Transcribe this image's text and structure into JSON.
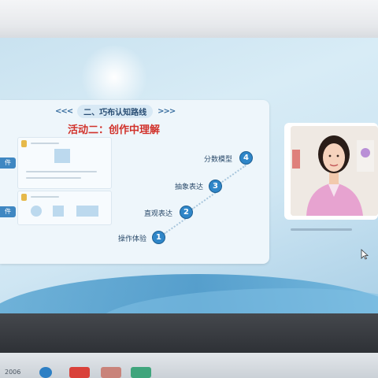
{
  "slide": {
    "section_header": "二、巧布认知路线",
    "left_arrows": "<<<",
    "right_arrows": ">>>",
    "activity_title": "活动二：创作中理解",
    "side_tab_1": "件",
    "side_tab_2": "件"
  },
  "diagram": {
    "steps": [
      {
        "number": "1",
        "label": "操作体验"
      },
      {
        "number": "2",
        "label": "直观表达"
      },
      {
        "number": "3",
        "label": "抽象表达"
      },
      {
        "number": "4",
        "label": "分数模型"
      }
    ]
  },
  "taskbar": {
    "left_text": "2006",
    "right_text": ""
  },
  "colors": {
    "accent_blue": "#2f86c8",
    "title_red": "#d1322b"
  }
}
